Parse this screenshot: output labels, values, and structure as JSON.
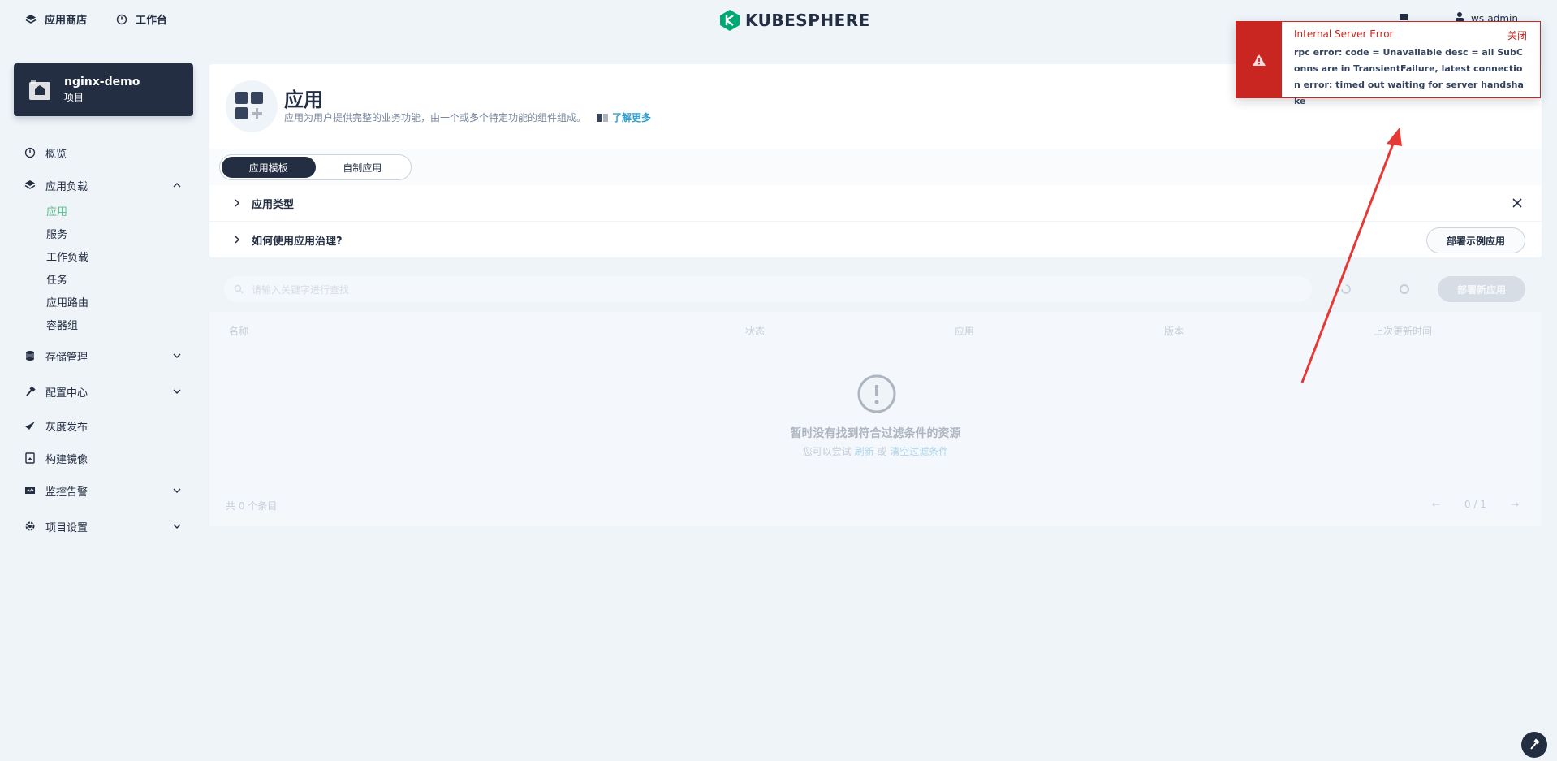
{
  "topnav": {
    "app_store": "应用商店",
    "workbench": "工作台",
    "logo_text": "KUBESPHERE",
    "user": "ws-admin"
  },
  "project": {
    "name": "nginx-demo",
    "type": "项目"
  },
  "sidebar": {
    "overview": "概览",
    "workloads": {
      "label": "应用负载",
      "items": [
        "应用",
        "服务",
        "工作负载",
        "任务",
        "应用路由",
        "容器组"
      ]
    },
    "storage": "存储管理",
    "config": "配置中心",
    "grayscale": "灰度发布",
    "build_image": "构建镜像",
    "monitoring": "监控告警",
    "settings": "项目设置"
  },
  "main": {
    "title": "应用",
    "description": "应用为用户提供完整的业务功能，由一个或多个特定功能的组件组成。",
    "learn_more": "了解更多",
    "tabs": [
      "应用模板",
      "自制应用"
    ],
    "info_rows": [
      "应用类型",
      "如何使用应用治理?"
    ],
    "deploy_demo": "部署示例应用",
    "search_placeholder": "请输入关键字进行查找",
    "deploy_new": "部署新应用",
    "columns": [
      "名称",
      "状态",
      "应用",
      "版本",
      "上次更新时间"
    ],
    "empty_title": "暂时没有找到符合过滤条件的资源",
    "empty_sub_prefix": "您可以尝试",
    "empty_refresh": "刷新",
    "empty_or": "或",
    "empty_clear": "清空过滤条件",
    "total": "共 0 个条目",
    "page": "0 / 1"
  },
  "error": {
    "title": "Internal Server Error",
    "close": "关闭",
    "message": "rpc error: code = Unavailable desc = all SubConns are in TransientFailure, latest connection error: timed out waiting for server handshake"
  },
  "colors": {
    "dark": "#242e42",
    "accent_green": "#55bc8a",
    "link_blue": "#329dce",
    "error_red": "#ca2621",
    "annotation_arrow": "#e53935"
  }
}
